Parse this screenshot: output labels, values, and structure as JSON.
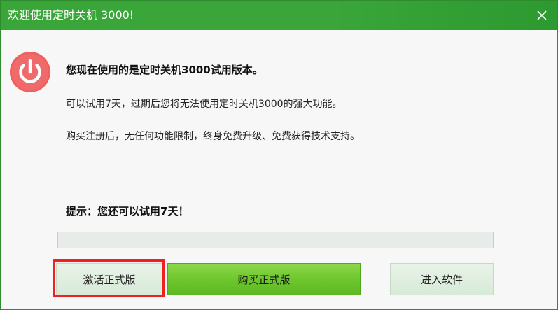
{
  "window": {
    "title": "欢迎使用定时关机 3000!",
    "close_label": "×"
  },
  "message": {
    "heading": "您现在使用的是定时关机3000试用版本。",
    "line1": "可以试用7天，过期后您将无法使用定时关机3000的强大功能。",
    "line2": "购买注册后，无任何功能限制，终身免费升级、免费获得技术支持。",
    "hint": "提示：您还可以试用7天！"
  },
  "progress": {
    "value": 0
  },
  "buttons": {
    "activate": "激活正式版",
    "buy": "购买正式版",
    "enter": "进入软件"
  },
  "colors": {
    "titlebar": "#39a53a",
    "power_icon": "#f0605f",
    "buy_button": "#6cc52b",
    "highlight": "#f02020"
  },
  "icons": {
    "app": "power-icon",
    "close": "close-icon"
  }
}
